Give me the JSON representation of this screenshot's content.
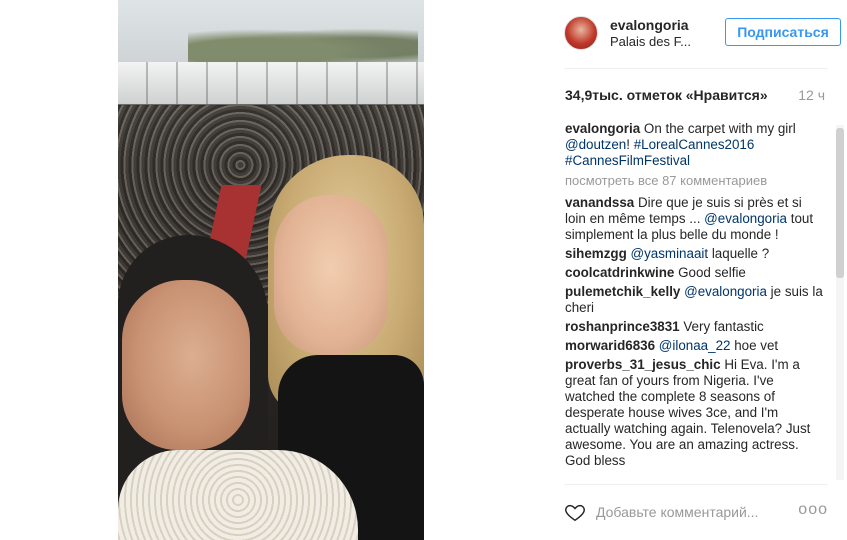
{
  "post": {
    "username": "evalongoria",
    "location": "Palais des F...",
    "follow_label": "Подписаться",
    "likes": "34,9тыс. отметок «Нравится»",
    "time": "12 ч",
    "caption": {
      "user": "evalongoria",
      "text_start": "On the carpet with my girl ",
      "mention": "@doutzen",
      "text_mid": "! ",
      "tag1": "#LorealCannes2016",
      "tag2": "#CannesFilmFestival"
    },
    "view_all": "посмотреть все 87 комментариев",
    "comments": [
      {
        "user": "vanandssa",
        "text": "Dire que je suis si près et si loin en même temps ... ",
        "mention": "@evalongoria",
        "text_after": " tout simplement la plus belle du monde !"
      },
      {
        "user": "sihemzgg",
        "text": "",
        "mention": "@yasminaait",
        "text_after": " laquelle ?"
      },
      {
        "user": "coolcatdrinkwine",
        "text": "Good selfie",
        "mention": "",
        "text_after": ""
      },
      {
        "user": "pulemetchik_kelly",
        "text": "",
        "mention": "@evalongoria",
        "text_after": " je suis la cheri"
      },
      {
        "user": "roshanprince3831",
        "text": "Very fantastic",
        "mention": "",
        "text_after": ""
      },
      {
        "user": "morwarid6836",
        "text": "",
        "mention": "@ilonaa_22",
        "text_after": " hoe vet"
      },
      {
        "user": "proverbs_31_jesus_chic",
        "text": "Hi Eva. I'm a great fan of yours from Nigeria. I've watched the complete 8 seasons of desperate house wives 3ce, and I'm actually watching again. Telenovela? Just awesome. You are an amazing actress. God bless",
        "mention": "",
        "text_after": ""
      }
    ],
    "add_comment_placeholder": "Добавьте комментарий...",
    "more_label": "ooo"
  },
  "icons": {
    "heart": "heart-icon",
    "more": "more-options-icon"
  },
  "colors": {
    "accent": "#3897f0",
    "mention": "#003569",
    "muted": "#999999"
  }
}
